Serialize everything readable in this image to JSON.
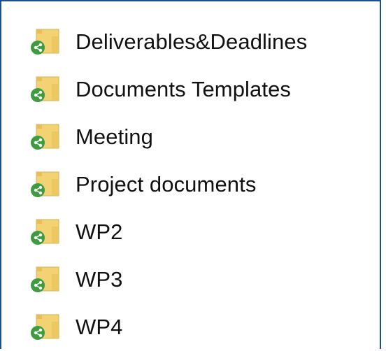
{
  "folder_list": {
    "icon": "shared-folder-icon",
    "items": [
      {
        "label": "Deliverables&Deadlines"
      },
      {
        "label": "Documents Templates"
      },
      {
        "label": "Meeting"
      },
      {
        "label": "Project documents"
      },
      {
        "label": "WP2"
      },
      {
        "label": "WP3"
      },
      {
        "label": "WP4"
      }
    ]
  },
  "colors": {
    "folder": "#f3d273",
    "folder_dark": "#d9b24a",
    "share_badge": "#3f9b3f",
    "frame_border": "#1f4e8c"
  }
}
